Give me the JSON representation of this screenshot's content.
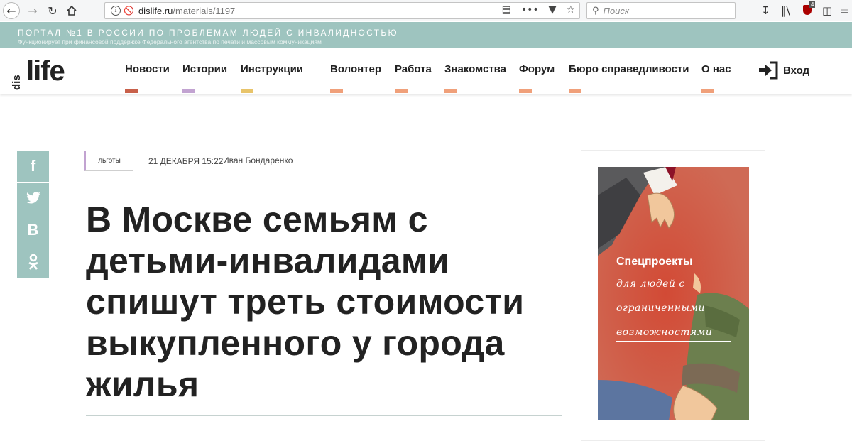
{
  "browser": {
    "url_domain": "dislife.ru",
    "url_path": "/materials/1197",
    "search_placeholder": "Поиск",
    "ublock_count": "4"
  },
  "site": {
    "strip_title": "ПОРТАЛ №1 В РОССИИ ПО ПРОБЛЕМАМ ЛЮДЕЙ С ИНВАЛИДНОСТЬЮ",
    "strip_subtitle": "Функционирует при финансовой поддержке Федерального агентства по печати и массовым коммуникациям",
    "logo_dis": "dis",
    "logo_life": "life",
    "accent_color": "#9ec4bf",
    "nav": [
      {
        "label": "Новости",
        "color": "#c8604a"
      },
      {
        "label": "Истории",
        "color": "#c2a3d1"
      },
      {
        "label": "Инструкции",
        "color": "#e8c46a"
      },
      {
        "label": "Волонтер",
        "color": "#f0a07a"
      },
      {
        "label": "Работа",
        "color": "#f0a07a"
      },
      {
        "label": "Знакомства",
        "color": "#f0a07a"
      },
      {
        "label": "Форум",
        "color": "#f0a07a"
      },
      {
        "label": "Бюро справедливости",
        "color": "#f0a07a"
      },
      {
        "label": "О нас",
        "color": "#f0a07a"
      }
    ],
    "login_label": "Вход"
  },
  "share": {
    "facebook": "f",
    "vk": "В",
    "ok": "ok"
  },
  "article": {
    "tag": "льготы",
    "date": "21 ДЕКАБРЯ 15:22",
    "author": "Иван Бондаренко",
    "headline_lines": [
      "В Москве семьям с",
      "детьми-инвалидами",
      "спишут треть стоимости",
      "выкупленного у города",
      "жилья"
    ]
  },
  "promo": {
    "title": "Спецпроекты",
    "lines": [
      "для людей с",
      "ограниченными",
      "возможностями"
    ]
  }
}
